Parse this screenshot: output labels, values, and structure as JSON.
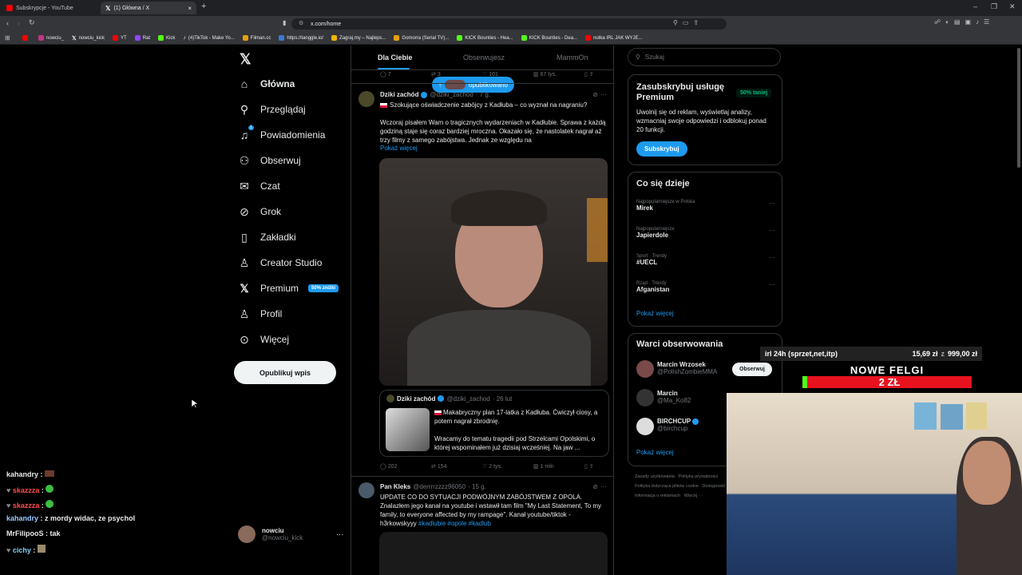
{
  "browser": {
    "tabs": [
      {
        "title": "Subskrypcje - YouTube",
        "color": "#ff0000"
      },
      {
        "title": "(1) Główna / X",
        "color": "#ffffff"
      }
    ],
    "new_tab": "+",
    "url": "x.com/home",
    "bookmarks": [
      {
        "label": "",
        "color": "#ff0000"
      },
      {
        "label": "nowciu_",
        "color": "#c13584"
      },
      {
        "label": "nowciu_kick",
        "color": "#000000"
      },
      {
        "label": "YT",
        "color": "#ff0000"
      },
      {
        "label": "Rat",
        "color": "#9146ff"
      },
      {
        "label": "Kick",
        "color": "#53fc18"
      },
      {
        "label": "(4)TikTok - Make Yo...",
        "color": "#000000"
      },
      {
        "label": "Filman.cc",
        "color": "#e5a00d"
      },
      {
        "label": "https://tanggle.io/",
        "color": "#3a7bd5"
      },
      {
        "label": "Zagraj.my – Najleps...",
        "color": "#f4b400"
      },
      {
        "label": "Gomorra (Serial TV)...",
        "color": "#e5a00d"
      },
      {
        "label": "KICK Bounties - Hea...",
        "color": "#53fc18"
      },
      {
        "label": "KICK Bounties - Dea...",
        "color": "#53fc18"
      },
      {
        "label": "nutka IRL JAK WYJE...",
        "color": "#ff0000"
      }
    ]
  },
  "sidebar": {
    "items": [
      {
        "label": "Główna",
        "icon": "home-icon",
        "glyph": "⌂"
      },
      {
        "label": "Przeglądaj",
        "icon": "search-icon",
        "glyph": "⚲"
      },
      {
        "label": "Powiadomienia",
        "icon": "bell-icon",
        "glyph": "🔔︎"
      },
      {
        "label": "Obserwuj",
        "icon": "follow-icon",
        "glyph": "👤︎"
      },
      {
        "label": "Czat",
        "icon": "mail-icon",
        "glyph": "✉"
      },
      {
        "label": "Grok",
        "icon": "grok-icon",
        "glyph": "⊘"
      },
      {
        "label": "Zakładki",
        "icon": "bookmark-icon",
        "glyph": "🔖︎"
      },
      {
        "label": "Creator Studio",
        "icon": "creator-icon",
        "glyph": "♙"
      },
      {
        "label": "Premium",
        "icon": "x-premium-icon",
        "glyph": "𝕏"
      },
      {
        "label": "Profil",
        "icon": "profile-icon",
        "glyph": "♙"
      },
      {
        "label": "Więcej",
        "icon": "more-icon",
        "glyph": "⋯"
      }
    ],
    "premium_badge": "50% zniżki",
    "notification_count": "1",
    "post_button": "Opublikuj wpis",
    "account": {
      "name": "nowciu",
      "handle": "@nowciu_kick",
      "more": "···"
    }
  },
  "feed": {
    "tabs": [
      "Dla Ciebie",
      "Obserwujesz",
      "MammOn"
    ],
    "top_stats": {
      "replies": "7",
      "retweets": "3",
      "likes": "101",
      "views": "67 tys."
    },
    "published_pill": "opublikowano",
    "tweet1": {
      "name": "Dziki zachód",
      "handle": "@dziki_zachod",
      "time": "· 7 g.",
      "title": "Szokujące oświadczenie zabójcy z Kadłuba – co wyznał na nagraniu?",
      "body": "Wczoraj pisałem Wam o tragicznych wydarzeniach w Kadłubie. Sprawa z każdą godziną staje się coraz bardziej mroczna. Okazało się, że nastolatek nagrał aż trzy filmy z samego zabójstwa. Jednak ze względu na",
      "show_more": "Pokaż więcej",
      "quote": {
        "name": "Dziki zachód",
        "handle": "@dziki_zachod",
        "time": "· 26 lut",
        "text1": "Makabryczny plan 17-latka z Kadłuba. Ćwiczył ciosy, a potem nagrał zbrodnię.",
        "text2": "Wracamy do tematu tragedii pod Strzelcami Opolskimi, o której wspominałem już dzisiaj wcześniej. Na jaw ..."
      },
      "stats": {
        "replies": "202",
        "retweets": "154",
        "likes": "2 tys.",
        "views": "1 mln"
      }
    },
    "tweet2": {
      "name": "Pan Kleks",
      "handle": "@derrrrzzzz96050",
      "time": "· 15 g.",
      "body": "UPDATE CO DO SYTUACJI PODWÓJNYM ZABÓJSTWEM Z OPOLA. Znalazłem jego kanał na youtube i wstawił tam film \"My Last Statement, To my family, to everyone affected by my rampage\". Kanał youtube/tiktok - h3rkowskyyy",
      "tags": "#kadlubie #opole #kadlub"
    }
  },
  "right": {
    "search_placeholder": "Szukaj",
    "premium": {
      "title": "Zasubskrybuj usługę Premium",
      "badge": "50% taniej",
      "desc": "Uwolnij się od reklam, wyświetlaj analizy, wzmacniaj swoje odpowiedzi i odblokuj ponad 20 funkcji.",
      "button": "Subskrybuj"
    },
    "trends": {
      "title": "Co się dzieje",
      "items": [
        {
          "sub": "Najpopularniejsze w Polska",
          "name": "Mirek"
        },
        {
          "sub": "Najpopularniejsze",
          "name": "Japierdole"
        },
        {
          "sub": "Sport · Trendy",
          "name": "#UECL"
        },
        {
          "sub": "Rząd · Trendy",
          "name": "Afganistan"
        }
      ],
      "more": "Pokaż więcej"
    },
    "follow": {
      "title": "Warci obserwowania",
      "items": [
        {
          "name": "Marcin Wrzosek",
          "handle": "@PolishZombieMMA",
          "button": "Obserwuj"
        },
        {
          "name": "Marcin",
          "handle": "@Ma_Ko82",
          "button": ""
        },
        {
          "name": "BIRCHCUP",
          "handle": "@birchcup",
          "button": ""
        }
      ],
      "more": "Pokaż więcej"
    },
    "footer": [
      "Zasady użytkowania",
      "Polityka prywatności",
      "Polityka dotycząca plików cookie",
      "Dostępność",
      "Informacja o reklamach",
      "Więcej ···"
    ]
  },
  "overlay": {
    "goal_text": "irl 24h (sprzet,net,itp)",
    "goal_amount": "15,69 zł",
    "goal_sep": "z",
    "goal_target": "999,00 zł",
    "banner_title": "NOWE FELGI",
    "banner_amount": "2 ZŁ",
    "chat": [
      {
        "user": "kahandry",
        "msg": "",
        "color": "#e7e9ea"
      },
      {
        "user": "skazzza",
        "msg": "",
        "color": "#ff4d4d"
      },
      {
        "user": "skazzza",
        "msg": "",
        "color": "#ff4d4d"
      },
      {
        "user": "kahandry",
        "msg": "z mordy widac, ze psychol",
        "color": "#e7e9ea"
      },
      {
        "user": "MrFilipooS",
        "msg": "tak",
        "color": "#e7e9ea"
      },
      {
        "user": "cichy",
        "msg": "",
        "color": "#7fd1ff"
      }
    ]
  }
}
